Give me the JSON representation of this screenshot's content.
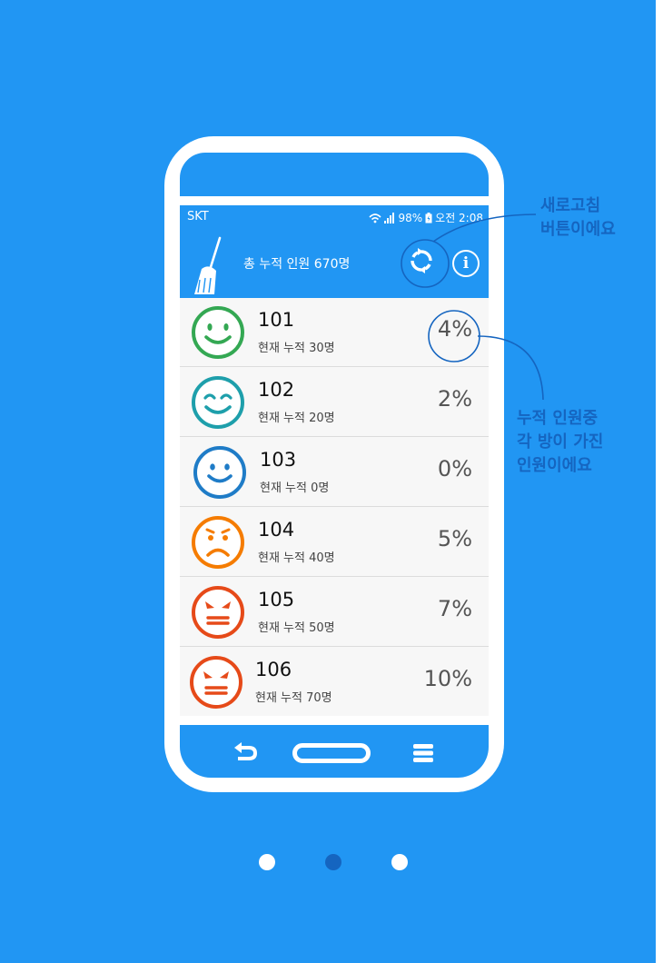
{
  "status_bar": {
    "carrier": "SKT",
    "battery": "98%",
    "time": "오전 2:08"
  },
  "app_bar": {
    "total_label": "총 누적 인원 670명",
    "info_glyph": "i"
  },
  "rooms": [
    {
      "name": "101",
      "stat": "현재 누적 30명",
      "percent": "4%",
      "mood": "happy",
      "color": "#34a853"
    },
    {
      "name": "102",
      "stat": "현재 누적 20명",
      "percent": "2%",
      "mood": "content",
      "color": "#1e9fab"
    },
    {
      "name": "103",
      "stat": "현재 누적 0명",
      "percent": "0%",
      "mood": "smile",
      "color": "#1f7cc7"
    },
    {
      "name": "104",
      "stat": "현재 누적 40명",
      "percent": "5%",
      "mood": "sad",
      "color": "#f57c00"
    },
    {
      "name": "105",
      "stat": "현재 누적 50명",
      "percent": "7%",
      "mood": "angry",
      "color": "#e64a19"
    },
    {
      "name": "106",
      "stat": "현재 누적 70명",
      "percent": "10%",
      "mood": "angry",
      "color": "#e64a19"
    }
  ],
  "annotations": {
    "refresh_line1": "새로고침",
    "refresh_line2": "버튼이에요",
    "percent_line1": "누적 인원중",
    "percent_line2": "각 방이 가진",
    "percent_line3": "인원이에요"
  },
  "pager": {
    "total": 3,
    "active": 1
  },
  "colors": {
    "background": "#2196f3",
    "annotation": "#1565c0",
    "active_dot": "#1565c0"
  }
}
